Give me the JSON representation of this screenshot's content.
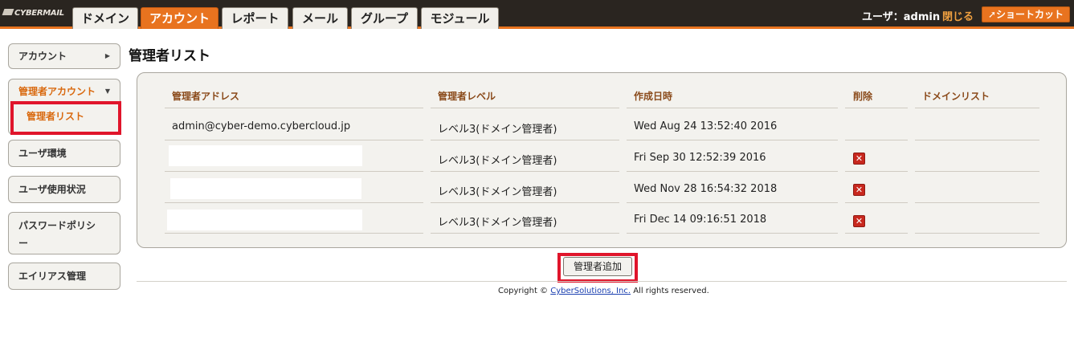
{
  "app": {
    "logo_text": "CYBERMAIL"
  },
  "nav": {
    "tabs": [
      {
        "label": "ドメイン",
        "active": false
      },
      {
        "label": "アカウント",
        "active": true
      },
      {
        "label": "レポート",
        "active": false
      },
      {
        "label": "メール",
        "active": false
      },
      {
        "label": "グループ",
        "active": false
      },
      {
        "label": "モジュール",
        "active": false
      }
    ],
    "user_label": "ユーザ：admin",
    "logout_label": "閉じる",
    "shortcut_label": "ショートカット"
  },
  "sidebar": {
    "items": [
      {
        "label": "アカウント"
      },
      {
        "label": "管理者アカウント"
      },
      {
        "label": "ユーザ環境"
      },
      {
        "label": "ユーザ使用状況"
      },
      {
        "label": "パスワードポリシー"
      },
      {
        "label": "エイリアス管理"
      }
    ],
    "sub_item": "管理者リスト"
  },
  "main": {
    "title": "管理者リスト",
    "columns": [
      "管理者アドレス",
      "管理者レベル",
      "作成日時",
      "削除",
      "ドメインリスト"
    ],
    "rows": [
      {
        "address": "admin@cyber-demo.cybercloud.jp",
        "level": "レベル3(ドメイン管理者)",
        "created": "Wed Aug 24 13:52:40 2016",
        "deletable": false
      },
      {
        "address": "",
        "level": "レベル3(ドメイン管理者)",
        "created": "Fri Sep 30 12:52:39 2016",
        "deletable": true
      },
      {
        "address": "",
        "level": "レベル3(ドメイン管理者)",
        "created": "Wed Nov 28 16:54:32 2018",
        "deletable": true
      },
      {
        "address": "",
        "level": "レベル3(ドメイン管理者)",
        "created": "Fri Dec 14 09:16:51 2018",
        "deletable": true
      }
    ],
    "add_button_label": "管理者追加"
  },
  "footer": {
    "prefix": "Copyright © ",
    "company": "CyberSolutions, Inc.",
    "suffix": " All rights reserved."
  },
  "colors": {
    "accent": "#e8731f",
    "highlight": "#e0152b",
    "delete": "#c8281e"
  }
}
